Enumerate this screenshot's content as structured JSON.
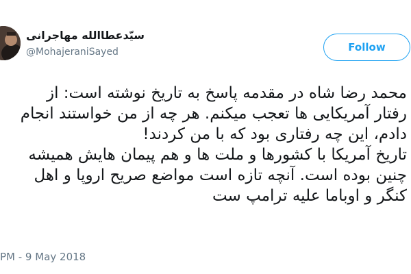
{
  "user": {
    "display_name": "سیّدعطاالله مهاجرانی",
    "handle": "@MohajeraniSayed"
  },
  "follow_button_label": "Follow",
  "tweet": {
    "lines": [
      "محمد رضا شاه  در مقدمه پاسخ به تاریخ نوشته است: از",
      "رفتار آمریکایی ها تعجب میکنم. هر چه از من خواستند انجام",
      "دادم، این چه رفتاری بود که با من کردند!",
      "تاریخ آمریکا با کشورها و ملت ها و  هم پیمان هایش همیشه",
      "چنین بوده است. آنچه تازه است مواضع صریح اروپا و اهل",
      "کنگر و اوباما علیه ترامپ ست"
    ],
    "timestamp": "PM - 9 May 2018"
  },
  "colors": {
    "accent": "#1da1f2",
    "secondary_text": "#657786"
  }
}
